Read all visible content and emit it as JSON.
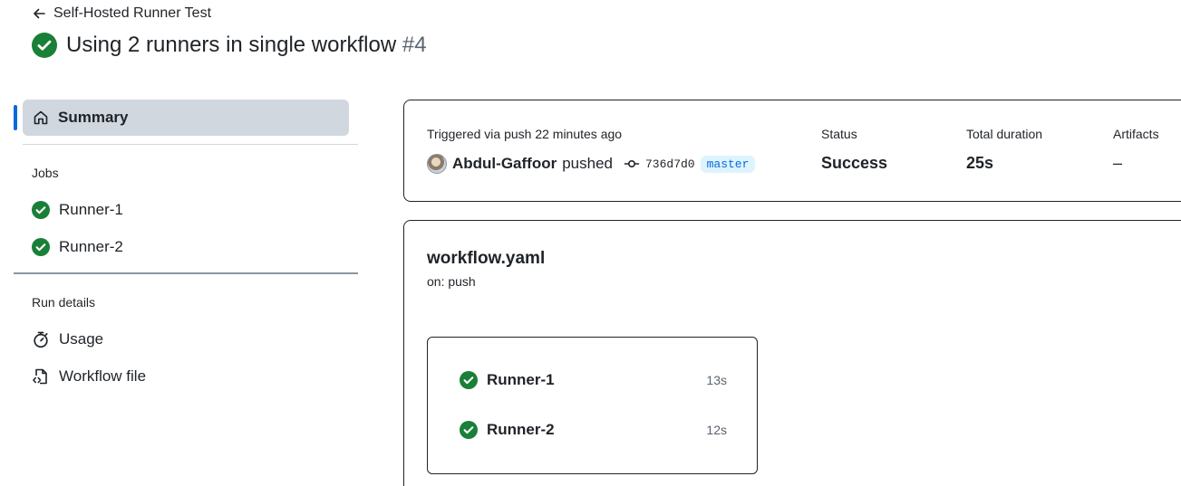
{
  "header": {
    "back_label": "Self-Hosted Runner Test",
    "run_title": "Using 2 runners in single workflow",
    "run_number": "#4"
  },
  "sidebar": {
    "summary_label": "Summary",
    "jobs_section": "Jobs",
    "jobs": [
      {
        "label": "Runner-1",
        "status": "success"
      },
      {
        "label": "Runner-2",
        "status": "success"
      }
    ],
    "run_details_section": "Run details",
    "usage_label": "Usage",
    "workflow_file_label": "Workflow file"
  },
  "summary": {
    "trigger_text": "Triggered via push 22 minutes ago",
    "author": "Abdul-Gaffoor",
    "action": "pushed",
    "commit_sha": "736d7d0",
    "branch": "master",
    "status_label": "Status",
    "status_value": "Success",
    "duration_label": "Total duration",
    "duration_value": "25s",
    "artifacts_label": "Artifacts",
    "artifacts_value": "–"
  },
  "workflow": {
    "file_name": "workflow.yaml",
    "trigger": "on: push",
    "jobs": [
      {
        "name": "Runner-1",
        "duration": "13s"
      },
      {
        "name": "Runner-2",
        "duration": "12s"
      }
    ]
  },
  "colors": {
    "success": "#1a7f37",
    "accent": "#0969da",
    "selected_bg": "#d0d7de"
  },
  "icons": {
    "back": "arrow-left-icon",
    "status": "check-circle-fill-icon",
    "summary": "home-icon",
    "usage": "stopwatch-icon",
    "workflow_file": "file-code-icon",
    "commit": "git-commit-icon"
  }
}
